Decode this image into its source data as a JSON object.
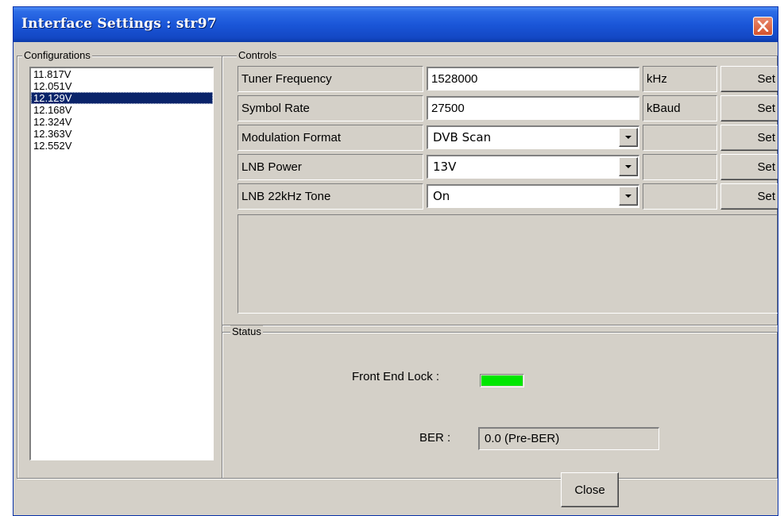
{
  "window": {
    "title": "Interface Settings : str97",
    "close_icon": "close-x-icon"
  },
  "configurations": {
    "label": "Configurations",
    "items": [
      "11.817V",
      "12.051V",
      "12.129V",
      "12.168V",
      "12.324V",
      "12.363V",
      "12.552V"
    ],
    "selected": "12.129V"
  },
  "controls": {
    "label": "Controls",
    "rows": [
      {
        "label": "Tuner Frequency",
        "value": "1528000",
        "unit": "kHz",
        "set": "Set"
      },
      {
        "label": "Symbol Rate",
        "value": "27500",
        "unit": "kBaud",
        "set": "Set"
      },
      {
        "label": "Modulation Format",
        "value": "DVB Scan",
        "unit": "",
        "set": "Set"
      },
      {
        "label": "LNB Power",
        "value": "13V",
        "unit": "",
        "set": "Set"
      },
      {
        "label": "LNB 22kHz Tone",
        "value": "On",
        "unit": "",
        "set": "Set"
      }
    ]
  },
  "status": {
    "label": "Status",
    "front_end_lock_label": "Front End Lock :",
    "front_end_lock_color": "#00e600",
    "ber_label": "BER :",
    "ber_value": "0.0 (Pre-BER)"
  },
  "footer": {
    "close_label": "Close"
  },
  "colors": {
    "titlebar": "#1a56d8",
    "selection": "#0a246a",
    "dialog_face": "#d4d0c8",
    "close_button": "#d5522d"
  }
}
